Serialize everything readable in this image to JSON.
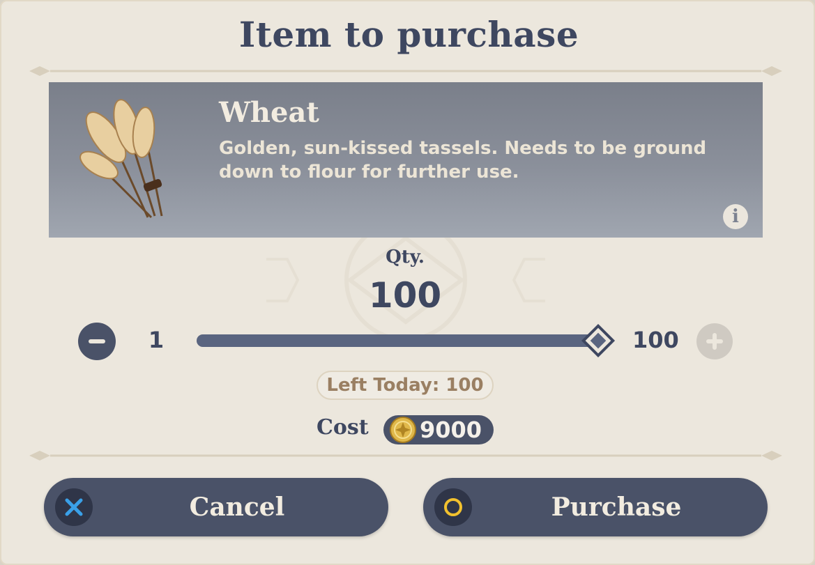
{
  "dialog": {
    "title": "Item to purchase"
  },
  "item": {
    "name": "Wheat",
    "description": "Golden, sun-kissed tassels. Needs to be ground down to flour for further use.",
    "image_icon": "wheat-bundle-icon",
    "info_icon": "info-icon",
    "info_glyph": "i"
  },
  "quantity": {
    "label": "Qty.",
    "value": "100",
    "min_label": "1",
    "max_label": "100",
    "slider_fraction": 1.0,
    "left_today": "Left Today: 100"
  },
  "cost": {
    "label": "Cost",
    "value": "9000",
    "currency_icon": "mora-coin-icon"
  },
  "buttons": {
    "cancel": {
      "label": "Cancel",
      "icon": "cross-icon",
      "icon_color": "#3aa0e8"
    },
    "purchase": {
      "label": "Purchase",
      "icon": "circle-icon",
      "icon_color": "#f2c12e"
    }
  },
  "colors": {
    "background": "#ece7dd",
    "text_dark": "#3e4760",
    "button": "#4a5268",
    "accent_brown": "#9a7f62"
  }
}
